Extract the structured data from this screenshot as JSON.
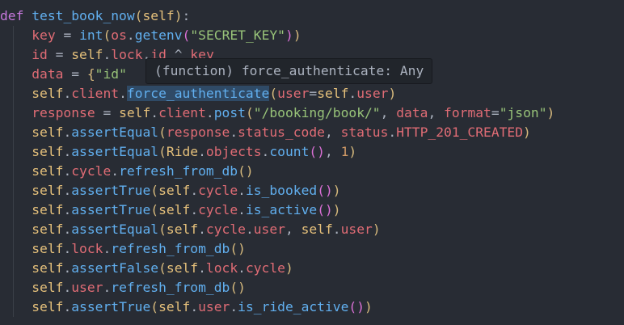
{
  "editor": {
    "language": "python",
    "colors": {
      "background": "#282c34",
      "keyword": "#c678dd",
      "function": "#61afef",
      "self": "#e5c07b",
      "variable": "#e06c75",
      "string": "#98c379",
      "number": "#d19a66",
      "text": "#abb2bf",
      "tooltip_background": "#21252b",
      "highlight": "#2f4a66"
    },
    "lines": [
      [
        {
          "t": "def",
          "c": "kw"
        },
        {
          "t": " ",
          "c": "p"
        },
        {
          "t": "test_book_now",
          "c": "fn"
        },
        {
          "t": "(",
          "c": "p1"
        },
        {
          "t": "self",
          "c": "self"
        },
        {
          "t": ")",
          "c": "p1"
        },
        {
          "t": ":",
          "c": "p"
        }
      ],
      [
        {
          "t": "    ",
          "c": "p"
        },
        {
          "t": "key",
          "c": "var"
        },
        {
          "t": " = ",
          "c": "p"
        },
        {
          "t": "int",
          "c": "fn"
        },
        {
          "t": "(",
          "c": "p1"
        },
        {
          "t": "os",
          "c": "var"
        },
        {
          "t": ".",
          "c": "p"
        },
        {
          "t": "getenv",
          "c": "fn"
        },
        {
          "t": "(",
          "c": "p2"
        },
        {
          "t": "\"SECRET_KEY\"",
          "c": "str"
        },
        {
          "t": ")",
          "c": "p2"
        },
        {
          "t": ")",
          "c": "p1"
        }
      ],
      [
        {
          "t": "    ",
          "c": "p"
        },
        {
          "t": "id",
          "c": "var"
        },
        {
          "t": " = ",
          "c": "p"
        },
        {
          "t": "self",
          "c": "self"
        },
        {
          "t": ".",
          "c": "p"
        },
        {
          "t": "lock",
          "c": "var"
        },
        {
          "t": ".",
          "c": "p"
        },
        {
          "t": "id",
          "c": "var"
        },
        {
          "t": " ^ ",
          "c": "p"
        },
        {
          "t": "key",
          "c": "var"
        }
      ],
      [
        {
          "t": "    ",
          "c": "p"
        },
        {
          "t": "data",
          "c": "var"
        },
        {
          "t": " = ",
          "c": "p"
        },
        {
          "t": "{",
          "c": "p1"
        },
        {
          "t": "\"id\"",
          "c": "str"
        }
      ],
      [
        {
          "t": "    ",
          "c": "p"
        },
        {
          "t": "self",
          "c": "self"
        },
        {
          "t": ".",
          "c": "p"
        },
        {
          "t": "client",
          "c": "var"
        },
        {
          "t": ".",
          "c": "p"
        },
        {
          "t": "force_authenticate",
          "c": "fn",
          "hl": true
        },
        {
          "t": "(",
          "c": "p1"
        },
        {
          "t": "user",
          "c": "var"
        },
        {
          "t": "=",
          "c": "p"
        },
        {
          "t": "self",
          "c": "self"
        },
        {
          "t": ".",
          "c": "p"
        },
        {
          "t": "user",
          "c": "var"
        },
        {
          "t": ")",
          "c": "p1"
        }
      ],
      [
        {
          "t": "    ",
          "c": "p"
        },
        {
          "t": "response",
          "c": "var"
        },
        {
          "t": " = ",
          "c": "p"
        },
        {
          "t": "self",
          "c": "self"
        },
        {
          "t": ".",
          "c": "p"
        },
        {
          "t": "client",
          "c": "var"
        },
        {
          "t": ".",
          "c": "p"
        },
        {
          "t": "post",
          "c": "fn"
        },
        {
          "t": "(",
          "c": "p1"
        },
        {
          "t": "\"/booking/book/\"",
          "c": "str"
        },
        {
          "t": ", ",
          "c": "p"
        },
        {
          "t": "data",
          "c": "var"
        },
        {
          "t": ", ",
          "c": "p"
        },
        {
          "t": "format",
          "c": "var"
        },
        {
          "t": "=",
          "c": "p"
        },
        {
          "t": "\"json\"",
          "c": "str"
        },
        {
          "t": ")",
          "c": "p1"
        }
      ],
      [
        {
          "t": "    ",
          "c": "p"
        },
        {
          "t": "self",
          "c": "self"
        },
        {
          "t": ".",
          "c": "p"
        },
        {
          "t": "assertEqual",
          "c": "fn"
        },
        {
          "t": "(",
          "c": "p1"
        },
        {
          "t": "response",
          "c": "var"
        },
        {
          "t": ".",
          "c": "p"
        },
        {
          "t": "status_code",
          "c": "var"
        },
        {
          "t": ", ",
          "c": "p"
        },
        {
          "t": "status",
          "c": "var"
        },
        {
          "t": ".",
          "c": "p"
        },
        {
          "t": "HTTP_201_CREATED",
          "c": "const"
        },
        {
          "t": ")",
          "c": "p1"
        }
      ],
      [
        {
          "t": "    ",
          "c": "p"
        },
        {
          "t": "self",
          "c": "self"
        },
        {
          "t": ".",
          "c": "p"
        },
        {
          "t": "assertEqual",
          "c": "fn"
        },
        {
          "t": "(",
          "c": "p1"
        },
        {
          "t": "Ride",
          "c": "cls"
        },
        {
          "t": ".",
          "c": "p"
        },
        {
          "t": "objects",
          "c": "var"
        },
        {
          "t": ".",
          "c": "p"
        },
        {
          "t": "count",
          "c": "fn"
        },
        {
          "t": "()",
          "c": "p2"
        },
        {
          "t": ", ",
          "c": "p"
        },
        {
          "t": "1",
          "c": "num"
        },
        {
          "t": ")",
          "c": "p1"
        }
      ],
      [
        {
          "t": "    ",
          "c": "p"
        },
        {
          "t": "self",
          "c": "self"
        },
        {
          "t": ".",
          "c": "p"
        },
        {
          "t": "cycle",
          "c": "var"
        },
        {
          "t": ".",
          "c": "p"
        },
        {
          "t": "refresh_from_db",
          "c": "fn"
        },
        {
          "t": "()",
          "c": "p1"
        }
      ],
      [
        {
          "t": "    ",
          "c": "p"
        },
        {
          "t": "self",
          "c": "self"
        },
        {
          "t": ".",
          "c": "p"
        },
        {
          "t": "assertTrue",
          "c": "fn"
        },
        {
          "t": "(",
          "c": "p1"
        },
        {
          "t": "self",
          "c": "self"
        },
        {
          "t": ".",
          "c": "p"
        },
        {
          "t": "cycle",
          "c": "var"
        },
        {
          "t": ".",
          "c": "p"
        },
        {
          "t": "is_booked",
          "c": "fn"
        },
        {
          "t": "()",
          "c": "p2"
        },
        {
          "t": ")",
          "c": "p1"
        }
      ],
      [
        {
          "t": "    ",
          "c": "p"
        },
        {
          "t": "self",
          "c": "self"
        },
        {
          "t": ".",
          "c": "p"
        },
        {
          "t": "assertTrue",
          "c": "fn"
        },
        {
          "t": "(",
          "c": "p1"
        },
        {
          "t": "self",
          "c": "self"
        },
        {
          "t": ".",
          "c": "p"
        },
        {
          "t": "cycle",
          "c": "var"
        },
        {
          "t": ".",
          "c": "p"
        },
        {
          "t": "is_active",
          "c": "fn"
        },
        {
          "t": "()",
          "c": "p2"
        },
        {
          "t": ")",
          "c": "p1"
        }
      ],
      [
        {
          "t": "    ",
          "c": "p"
        },
        {
          "t": "self",
          "c": "self"
        },
        {
          "t": ".",
          "c": "p"
        },
        {
          "t": "assertEqual",
          "c": "fn"
        },
        {
          "t": "(",
          "c": "p1"
        },
        {
          "t": "self",
          "c": "self"
        },
        {
          "t": ".",
          "c": "p"
        },
        {
          "t": "cycle",
          "c": "var"
        },
        {
          "t": ".",
          "c": "p"
        },
        {
          "t": "user",
          "c": "var"
        },
        {
          "t": ", ",
          "c": "p"
        },
        {
          "t": "self",
          "c": "self"
        },
        {
          "t": ".",
          "c": "p"
        },
        {
          "t": "user",
          "c": "var"
        },
        {
          "t": ")",
          "c": "p1"
        }
      ],
      [
        {
          "t": "    ",
          "c": "p"
        },
        {
          "t": "self",
          "c": "self"
        },
        {
          "t": ".",
          "c": "p"
        },
        {
          "t": "lock",
          "c": "var"
        },
        {
          "t": ".",
          "c": "p"
        },
        {
          "t": "refresh_from_db",
          "c": "fn"
        },
        {
          "t": "()",
          "c": "p1"
        }
      ],
      [
        {
          "t": "    ",
          "c": "p"
        },
        {
          "t": "self",
          "c": "self"
        },
        {
          "t": ".",
          "c": "p"
        },
        {
          "t": "assertFalse",
          "c": "fn"
        },
        {
          "t": "(",
          "c": "p1"
        },
        {
          "t": "self",
          "c": "self"
        },
        {
          "t": ".",
          "c": "p"
        },
        {
          "t": "lock",
          "c": "var"
        },
        {
          "t": ".",
          "c": "p"
        },
        {
          "t": "cycle",
          "c": "var"
        },
        {
          "t": ")",
          "c": "p1"
        }
      ],
      [
        {
          "t": "    ",
          "c": "p"
        },
        {
          "t": "self",
          "c": "self"
        },
        {
          "t": ".",
          "c": "p"
        },
        {
          "t": "user",
          "c": "var"
        },
        {
          "t": ".",
          "c": "p"
        },
        {
          "t": "refresh_from_db",
          "c": "fn"
        },
        {
          "t": "()",
          "c": "p1"
        }
      ],
      [
        {
          "t": "    ",
          "c": "p"
        },
        {
          "t": "self",
          "c": "self"
        },
        {
          "t": ".",
          "c": "p"
        },
        {
          "t": "assertTrue",
          "c": "fn"
        },
        {
          "t": "(",
          "c": "p1"
        },
        {
          "t": "self",
          "c": "self"
        },
        {
          "t": ".",
          "c": "p"
        },
        {
          "t": "user",
          "c": "var"
        },
        {
          "t": ".",
          "c": "p"
        },
        {
          "t": "is_ride_active",
          "c": "fn"
        },
        {
          "t": "()",
          "c": "p2"
        },
        {
          "t": ")",
          "c": "p1"
        }
      ]
    ]
  },
  "tooltip": {
    "text": "(function) force_authenticate: Any"
  }
}
